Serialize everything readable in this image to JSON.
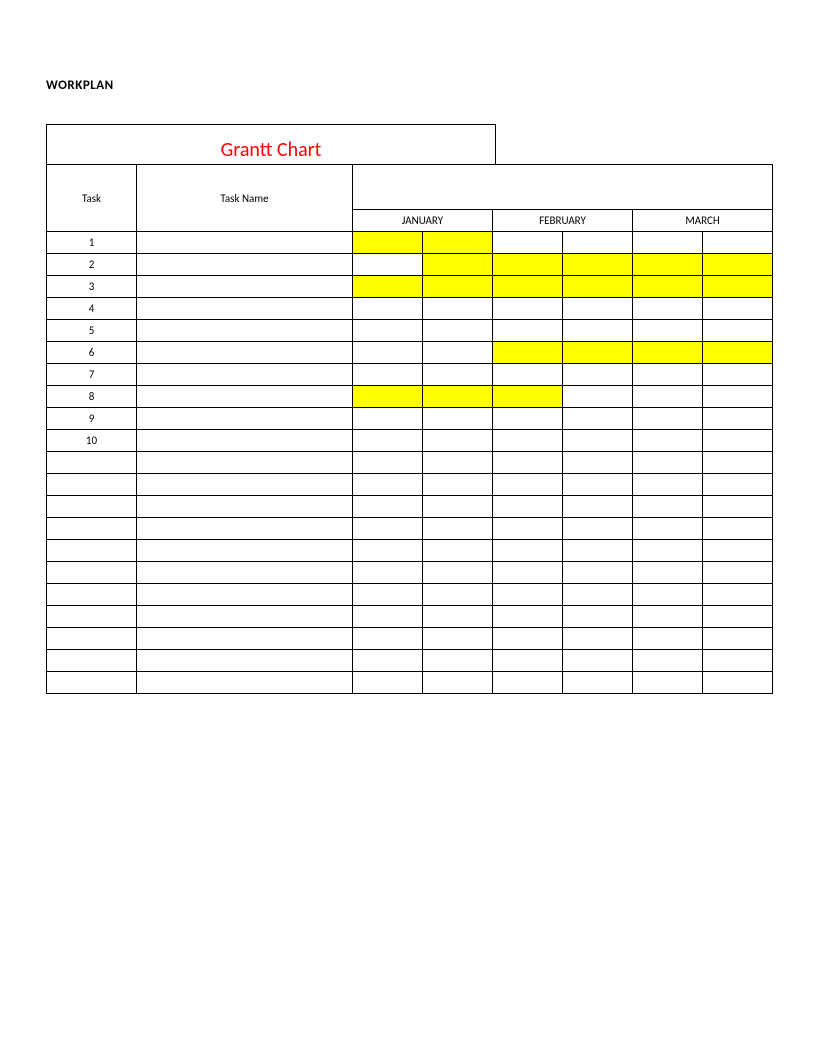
{
  "page_title": "WORKPLAN",
  "chart_title": "Grantt Chart",
  "headers": {
    "task": "Task",
    "task_name": "Task Name",
    "months": [
      "JANUARY",
      "FEBRUARY",
      "MARCH"
    ]
  },
  "rows": [
    {
      "num": "1",
      "name": "",
      "cells": [
        true,
        true,
        false,
        false,
        false,
        false
      ]
    },
    {
      "num": "2",
      "name": "",
      "cells": [
        false,
        true,
        true,
        true,
        true,
        true
      ]
    },
    {
      "num": "3",
      "name": "",
      "cells": [
        true,
        true,
        true,
        true,
        true,
        true
      ]
    },
    {
      "num": "4",
      "name": "",
      "cells": [
        false,
        false,
        false,
        false,
        false,
        false
      ]
    },
    {
      "num": "5",
      "name": "",
      "cells": [
        false,
        false,
        false,
        false,
        false,
        false
      ]
    },
    {
      "num": "6",
      "name": "",
      "cells": [
        false,
        false,
        true,
        true,
        true,
        true
      ]
    },
    {
      "num": "7",
      "name": "",
      "cells": [
        false,
        false,
        false,
        false,
        false,
        false
      ]
    },
    {
      "num": "8",
      "name": "",
      "cells": [
        true,
        true,
        true,
        false,
        false,
        false
      ]
    },
    {
      "num": "9",
      "name": "",
      "cells": [
        false,
        false,
        false,
        false,
        false,
        false
      ]
    },
    {
      "num": "10",
      "name": "",
      "cells": [
        false,
        false,
        false,
        false,
        false,
        false
      ]
    },
    {
      "num": "",
      "name": "",
      "cells": [
        false,
        false,
        false,
        false,
        false,
        false
      ]
    },
    {
      "num": "",
      "name": "",
      "cells": [
        false,
        false,
        false,
        false,
        false,
        false
      ]
    },
    {
      "num": "",
      "name": "",
      "cells": [
        false,
        false,
        false,
        false,
        false,
        false
      ]
    },
    {
      "num": "",
      "name": "",
      "cells": [
        false,
        false,
        false,
        false,
        false,
        false
      ]
    },
    {
      "num": "",
      "name": "",
      "cells": [
        false,
        false,
        false,
        false,
        false,
        false
      ]
    },
    {
      "num": "",
      "name": "",
      "cells": [
        false,
        false,
        false,
        false,
        false,
        false
      ]
    },
    {
      "num": "",
      "name": "",
      "cells": [
        false,
        false,
        false,
        false,
        false,
        false
      ]
    },
    {
      "num": "",
      "name": "",
      "cells": [
        false,
        false,
        false,
        false,
        false,
        false
      ]
    },
    {
      "num": "",
      "name": "",
      "cells": [
        false,
        false,
        false,
        false,
        false,
        false
      ]
    },
    {
      "num": "",
      "name": "",
      "cells": [
        false,
        false,
        false,
        false,
        false,
        false
      ]
    },
    {
      "num": "",
      "name": "",
      "cells": [
        false,
        false,
        false,
        false,
        false,
        false
      ]
    }
  ],
  "chart_data": {
    "type": "bar",
    "title": "Grantt Chart",
    "xlabel": "",
    "ylabel": "Task",
    "categories": [
      "JANUARY-1",
      "JANUARY-2",
      "FEBRUARY-1",
      "FEBRUARY-2",
      "MARCH-1",
      "MARCH-2"
    ],
    "series": [
      {
        "name": "1",
        "values": [
          1,
          1,
          0,
          0,
          0,
          0
        ]
      },
      {
        "name": "2",
        "values": [
          0,
          1,
          1,
          1,
          1,
          1
        ]
      },
      {
        "name": "3",
        "values": [
          1,
          1,
          1,
          1,
          1,
          1
        ]
      },
      {
        "name": "4",
        "values": [
          0,
          0,
          0,
          0,
          0,
          0
        ]
      },
      {
        "name": "5",
        "values": [
          0,
          0,
          0,
          0,
          0,
          0
        ]
      },
      {
        "name": "6",
        "values": [
          0,
          0,
          1,
          1,
          1,
          1
        ]
      },
      {
        "name": "7",
        "values": [
          0,
          0,
          0,
          0,
          0,
          0
        ]
      },
      {
        "name": "8",
        "values": [
          1,
          1,
          1,
          0,
          0,
          0
        ]
      },
      {
        "name": "9",
        "values": [
          0,
          0,
          0,
          0,
          0,
          0
        ]
      },
      {
        "name": "10",
        "values": [
          0,
          0,
          0,
          0,
          0,
          0
        ]
      }
    ]
  }
}
